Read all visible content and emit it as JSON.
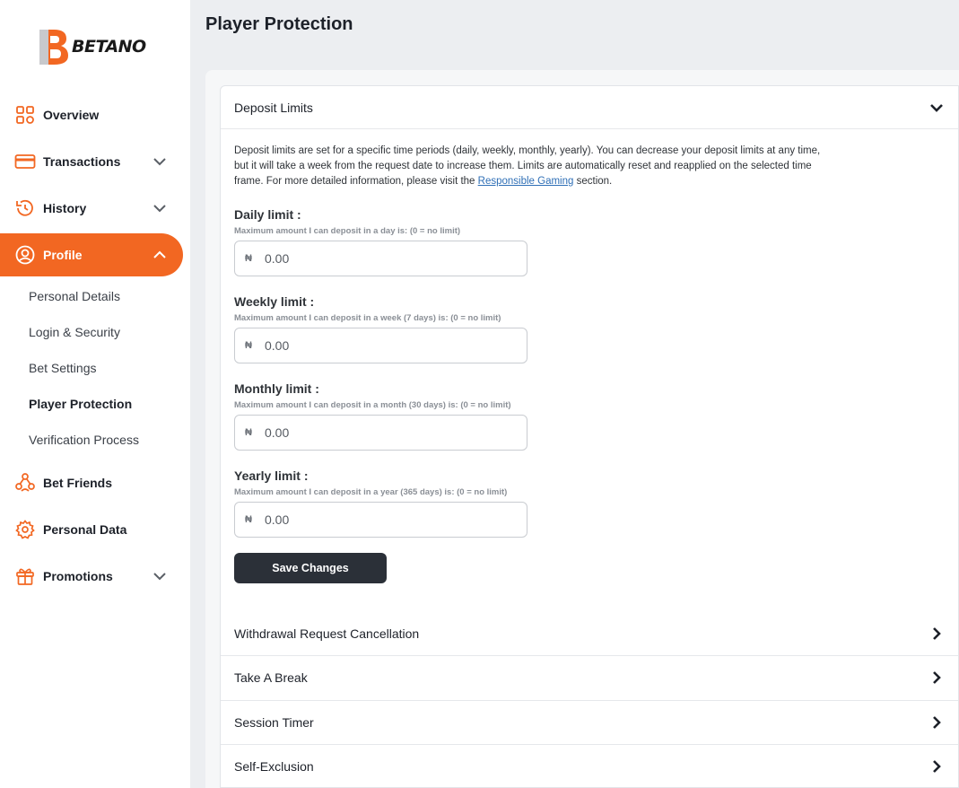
{
  "brand": {
    "name": "BETANO",
    "accent": "#f26722"
  },
  "sidebar": {
    "items": [
      {
        "label": "Overview",
        "icon": "grid-icon"
      },
      {
        "label": "Transactions",
        "icon": "card-icon"
      },
      {
        "label": "History",
        "icon": "history-icon"
      },
      {
        "label": "Profile",
        "icon": "user-icon"
      },
      {
        "label": "Bet Friends",
        "icon": "friends-icon"
      },
      {
        "label": "Personal Data",
        "icon": "gear-icon"
      },
      {
        "label": "Promotions",
        "icon": "gift-icon"
      }
    ],
    "profile_sub": [
      {
        "label": "Personal Details"
      },
      {
        "label": "Login & Security"
      },
      {
        "label": "Bet Settings"
      },
      {
        "label": "Player Protection"
      },
      {
        "label": "Verification Process"
      }
    ]
  },
  "page": {
    "title": "Player Protection"
  },
  "deposit": {
    "title": "Deposit Limits",
    "desc_before": "Deposit limits are set for a specific time periods (daily, weekly, monthly, yearly). You can decrease your deposit limits at any time, but it will take a week from the request date to increase them. Limits are automatically reset and reapplied on the selected time frame. For more detailed information, please visit the ",
    "desc_link": "Responsible Gaming",
    "desc_after": " section.",
    "currency_symbol": "₦",
    "limits": [
      {
        "label": "Daily limit :",
        "help": "Maximum amount I can deposit in a day is: (0 = no limit)",
        "value": "0.00"
      },
      {
        "label": "Weekly limit :",
        "help": "Maximum amount I can deposit in a week (7 days) is: (0 = no limit)",
        "value": "0.00"
      },
      {
        "label": "Monthly limit :",
        "help": "Maximum amount I can deposit in a month (30 days) is: (0 = no limit)",
        "value": "0.00"
      },
      {
        "label": "Yearly limit :",
        "help": "Maximum amount I can deposit in a year (365 days) is: (0 = no limit)",
        "value": "0.00"
      }
    ],
    "save_label": "Save Changes"
  },
  "sections": [
    {
      "label": "Withdrawal Request Cancellation"
    },
    {
      "label": "Take A Break"
    },
    {
      "label": "Session Timer"
    },
    {
      "label": "Self-Exclusion"
    }
  ]
}
